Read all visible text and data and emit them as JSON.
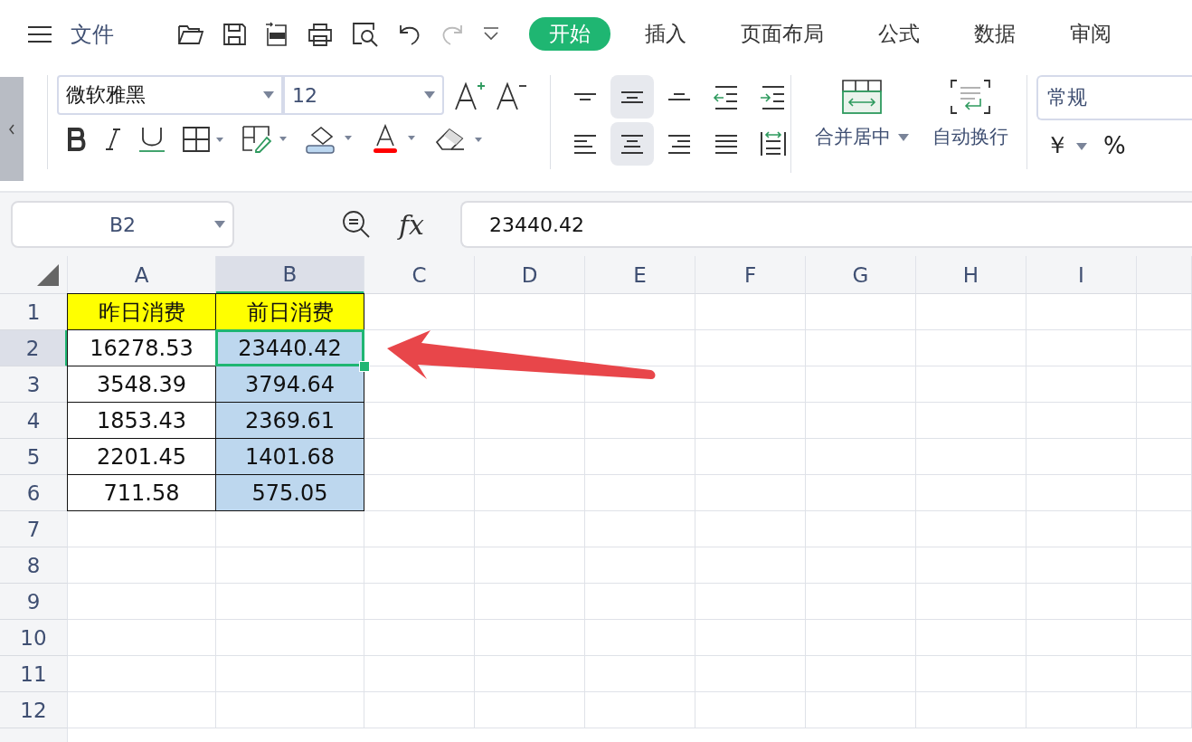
{
  "menu": {
    "file_label": "文件"
  },
  "tabs": [
    {
      "label": "开始",
      "selected": true
    },
    {
      "label": "插入",
      "selected": false
    },
    {
      "label": "页面布局",
      "selected": false
    },
    {
      "label": "公式",
      "selected": false
    },
    {
      "label": "数据",
      "selected": false
    },
    {
      "label": "审阅",
      "selected": false
    }
  ],
  "ribbon": {
    "font_name": "微软雅黑",
    "font_size": "12",
    "align_buttons": [
      {
        "kind": "top",
        "selected": false
      },
      {
        "kind": "middle",
        "selected": true
      },
      {
        "kind": "bottom",
        "selected": false
      },
      {
        "kind": "outdent",
        "selected": false
      },
      {
        "kind": "indent",
        "selected": false
      },
      {
        "kind": "left",
        "selected": false
      },
      {
        "kind": "center",
        "selected": true
      },
      {
        "kind": "right",
        "selected": false
      },
      {
        "kind": "justify",
        "selected": false
      },
      {
        "kind": "distribute",
        "selected": false
      }
    ],
    "merge_label": "合并居中",
    "wrap_label": "自动换行",
    "number_format": "常规",
    "currency": "￥",
    "percent": "%"
  },
  "formula_bar": {
    "name_box": "B2",
    "fx": "fx",
    "value": "23440.42"
  },
  "grid": {
    "columns": [
      {
        "label": "A",
        "selected": false
      },
      {
        "label": "B",
        "selected": true
      },
      {
        "label": "C",
        "selected": false
      },
      {
        "label": "D",
        "selected": false
      },
      {
        "label": "E",
        "selected": false
      },
      {
        "label": "F",
        "selected": false
      },
      {
        "label": "G",
        "selected": false
      },
      {
        "label": "H",
        "selected": false
      },
      {
        "label": "I",
        "selected": false
      }
    ],
    "rows": [
      {
        "label": "1",
        "selected": false,
        "cells": [
          {
            "text": "昨日消费",
            "highlight": true,
            "selected": false,
            "active": false
          },
          {
            "text": "前日消费",
            "highlight": true,
            "selected": false,
            "active": false
          }
        ]
      },
      {
        "label": "2",
        "selected": true,
        "cells": [
          {
            "text": "16278.53",
            "highlight": false,
            "selected": false,
            "active": false
          },
          {
            "text": "23440.42",
            "highlight": false,
            "selected": true,
            "active": true
          }
        ]
      },
      {
        "label": "3",
        "selected": false,
        "cells": [
          {
            "text": "3548.39",
            "highlight": false,
            "selected": false,
            "active": false
          },
          {
            "text": "3794.64",
            "highlight": false,
            "selected": true,
            "active": false
          }
        ]
      },
      {
        "label": "4",
        "selected": false,
        "cells": [
          {
            "text": "1853.43",
            "highlight": false,
            "selected": false,
            "active": false
          },
          {
            "text": "2369.61",
            "highlight": false,
            "selected": true,
            "active": false
          }
        ]
      },
      {
        "label": "5",
        "selected": false,
        "cells": [
          {
            "text": "2201.45",
            "highlight": false,
            "selected": false,
            "active": false
          },
          {
            "text": "1401.68",
            "highlight": false,
            "selected": true,
            "active": false
          }
        ]
      },
      {
        "label": "6",
        "selected": false,
        "cells": [
          {
            "text": "711.58",
            "highlight": false,
            "selected": false,
            "active": false
          },
          {
            "text": "575.05",
            "highlight": false,
            "selected": true,
            "active": false
          }
        ]
      },
      {
        "label": "7",
        "selected": false
      },
      {
        "label": "8",
        "selected": false
      },
      {
        "label": "9",
        "selected": false
      },
      {
        "label": "10",
        "selected": false
      },
      {
        "label": "11",
        "selected": false
      },
      {
        "label": "12",
        "selected": false
      }
    ]
  }
}
